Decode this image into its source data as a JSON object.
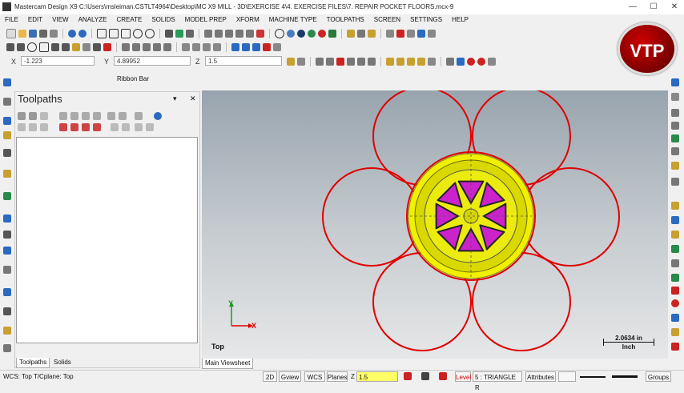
{
  "window": {
    "title": "Mastercam Design X9  C:\\Users\\msleiman.CSTLT4964\\Desktop\\MC X9 MILL - 3D\\EXERCISE 4\\4. EXERCISE FILES\\7. REPAIR POCKET FLOORS.mcx-9",
    "min_glyph": "—",
    "max_glyph": "☐",
    "close_glyph": "✕"
  },
  "menu": [
    "FILE",
    "EDIT",
    "VIEW",
    "ANALYZE",
    "CREATE",
    "SOLIDS",
    "MODEL PREP",
    "XFORM",
    "MACHINE TYPE",
    "TOOLPATHS",
    "SCREEN",
    "SETTINGS",
    "HELP"
  ],
  "coords": {
    "x_label": "X",
    "x_value": "-1.223",
    "y_label": "Y",
    "y_value": "4.89952",
    "z_label": "Z",
    "z_value": "1.5"
  },
  "badge": {
    "text": "VTP"
  },
  "ribbon": {
    "label": "Ribbon Bar"
  },
  "toolpaths_panel": {
    "title": "Toolpaths",
    "pin_glyph": "▾",
    "close_glyph": "✕",
    "tabs": [
      "Toolpaths",
      "Solids"
    ]
  },
  "viewport": {
    "view_name": "Top",
    "axis_x": "X",
    "axis_y": "Y",
    "scale_value": "2.0634 in",
    "scale_unit": "Inch",
    "sheet_tab": "Main Viewsheet"
  },
  "status": {
    "wcs_text": "WCS: Top  T/Cplane: Top",
    "btn_2d": "2D",
    "btn_gview": "Gview",
    "btn_wcs": "WCS",
    "btn_planes": "Planes",
    "z_label": "Z",
    "z_value": "1.5",
    "level_label": "Level",
    "level_value": "5 : TRIANGLE R",
    "attributes": "Attributes",
    "groups": "Groups"
  },
  "colors": {
    "accent_red": "#e00000",
    "part_yellow": "#e6e600",
    "pocket_purple": "#cc22cc",
    "toolbar_bg": "#f0f0f0"
  },
  "icons": [
    "app-logo-icon",
    "new-file-icon",
    "open-file-icon",
    "save-icon",
    "print-icon",
    "undo-icon",
    "redo-icon",
    "zoom-window-icon",
    "zoom-fit-icon",
    "rotate-icon",
    "shade-icon",
    "wireframe-icon",
    "sphere-icon",
    "level-icon",
    "color-icon",
    "analyze-icon",
    "settings-icon"
  ]
}
